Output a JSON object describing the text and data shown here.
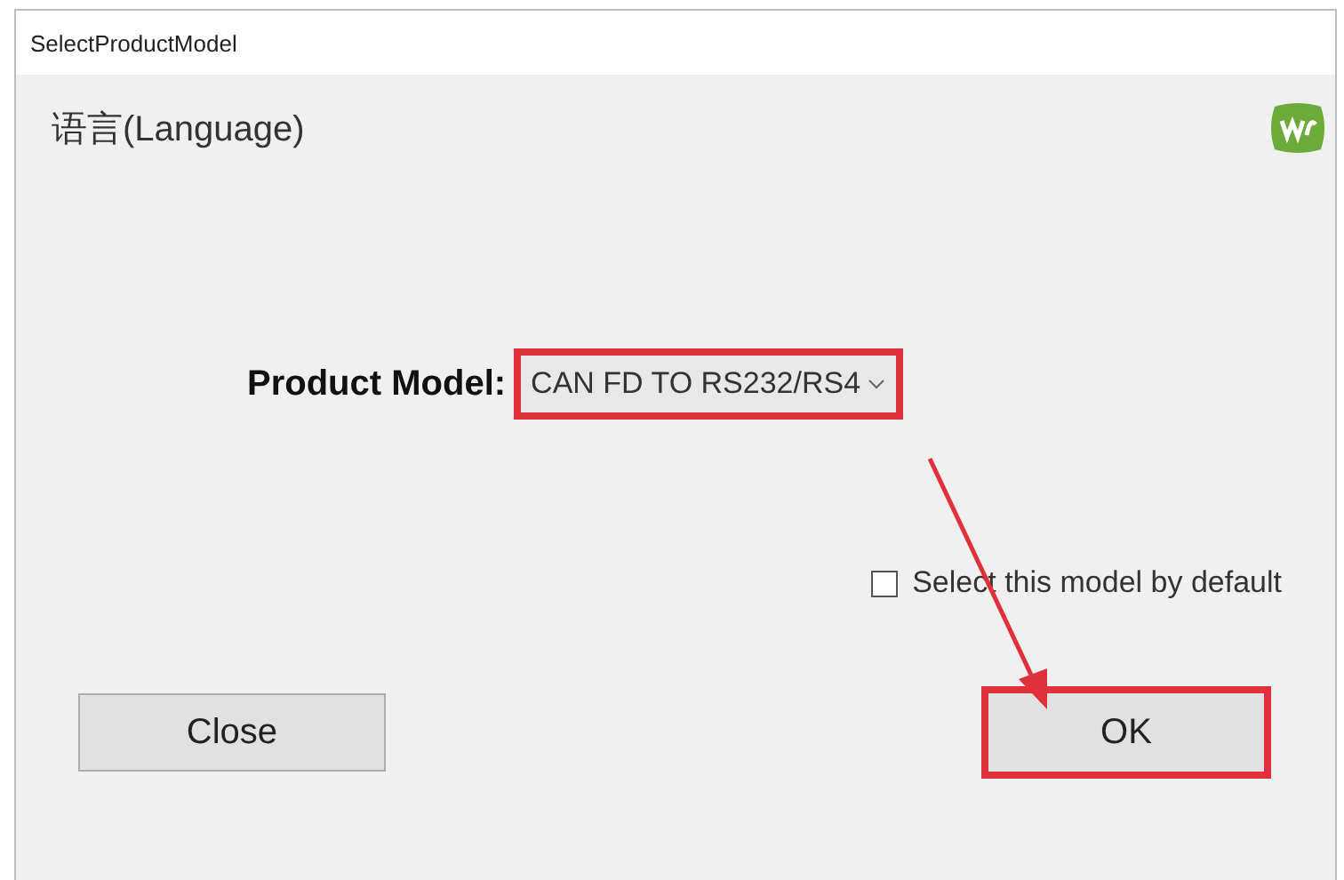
{
  "window": {
    "title": "SelectProductModel"
  },
  "language_label": "语言(Language)",
  "product_model": {
    "label": "Product Model:",
    "value": "CAN FD TO RS232/RS4",
    "highlighted": true
  },
  "default_checkbox": {
    "label": "Select this model by default",
    "checked": false
  },
  "buttons": [
    {
      "label": "Close",
      "highlighted": false
    },
    {
      "label": "OK",
      "highlighted": true
    }
  ]
}
